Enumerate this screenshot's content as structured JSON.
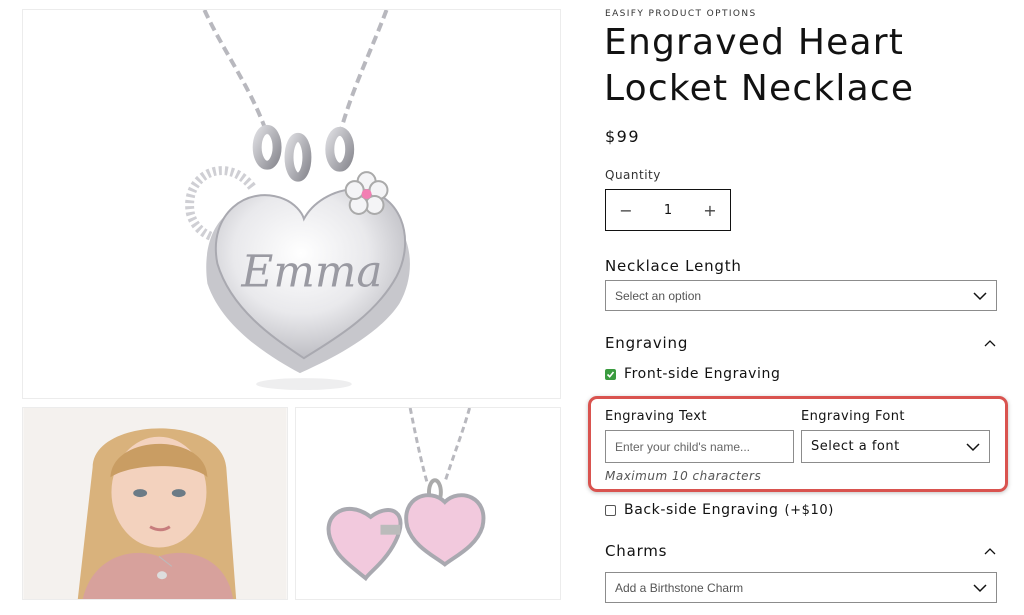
{
  "vendor": "EASIFY PRODUCT OPTIONS",
  "product": {
    "title": "Engraved Heart Locket Necklace",
    "price": "$99",
    "engraving_preview_text": "Emma"
  },
  "quantity": {
    "label": "Quantity",
    "minus": "−",
    "value": "1",
    "plus": "+"
  },
  "necklace_length": {
    "label": "Necklace Length",
    "placeholder": "Select an option"
  },
  "engraving": {
    "label": "Engraving",
    "front_label": "Front-side Engraving",
    "front_checked": true,
    "text_label": "Engraving Text",
    "text_placeholder": "Enter your child's name...",
    "font_label": "Engraving Font",
    "font_placeholder": "Select a font",
    "hint": "Maximum 10 characters",
    "back_label": "Back-side Engraving",
    "back_extra": "(+$10)",
    "back_checked": false
  },
  "charms": {
    "label": "Charms",
    "placeholder": "Add a Birthstone Charm"
  },
  "colors": {
    "highlight": "#d9534f",
    "checkbox_checked": "#3a9b3f",
    "text": "#121212"
  }
}
